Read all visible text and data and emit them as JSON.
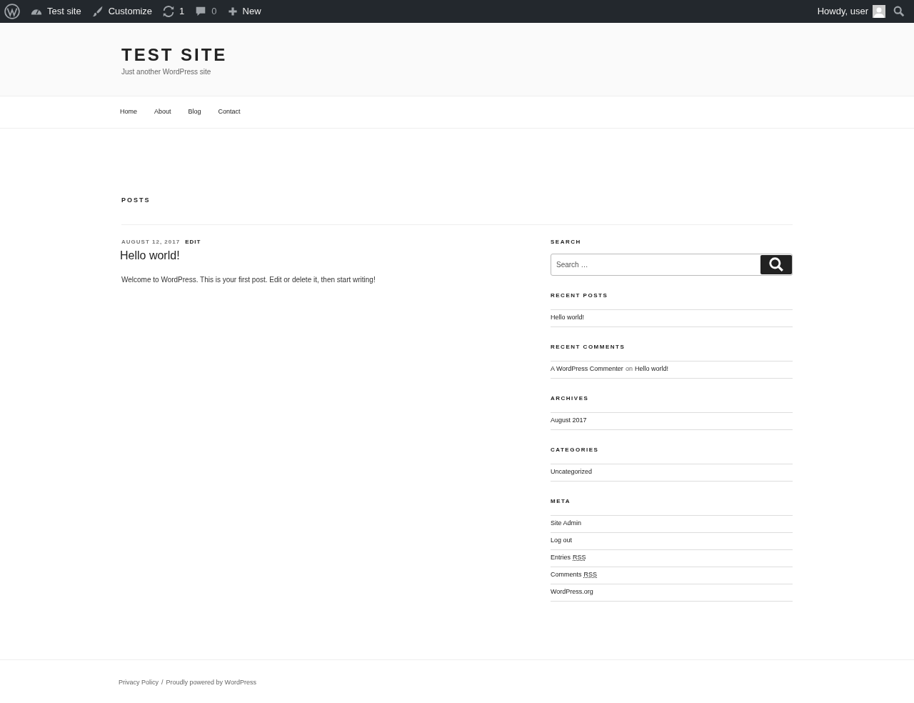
{
  "admin_bar": {
    "site": "Test site",
    "customize": "Customize",
    "updates": "1",
    "comments": "0",
    "new": "New",
    "greeting": "Howdy, user"
  },
  "site": {
    "title": "TEST SITE",
    "tagline": "Just another WordPress site"
  },
  "nav": [
    "Home",
    "About",
    "Blog",
    "Contact"
  ],
  "page_title": "POSTS",
  "post": {
    "date": "AUGUST 12, 2017",
    "edit": "EDIT",
    "title": "Hello world!",
    "excerpt": "Welcome to WordPress. This is your first post. Edit or delete it, then start writing!"
  },
  "sidebar": [
    {
      "kind": "search",
      "title": "SEARCH",
      "placeholder": "Search …"
    },
    {
      "kind": "list",
      "title": "RECENT POSTS",
      "items": [
        {
          "text": "Hello world!"
        }
      ]
    },
    {
      "kind": "comments",
      "title": "RECENT COMMENTS",
      "items": [
        {
          "author": "A WordPress Commenter",
          "joiner": "on",
          "post": "Hello world!"
        }
      ]
    },
    {
      "kind": "list",
      "title": "ARCHIVES",
      "items": [
        {
          "text": "August 2017"
        }
      ]
    },
    {
      "kind": "list",
      "title": "CATEGORIES",
      "items": [
        {
          "text": "Uncategorized"
        }
      ]
    },
    {
      "kind": "list",
      "title": "META",
      "items": [
        {
          "text": "Site Admin"
        },
        {
          "text": "Log out"
        },
        {
          "text": "Entries",
          "abbr": "RSS"
        },
        {
          "text": "Comments",
          "abbr": "RSS"
        },
        {
          "text": "WordPress.org"
        }
      ]
    }
  ],
  "footer": {
    "privacy": "Privacy Policy",
    "separator": "/",
    "powered": "Proudly powered by WordPress"
  }
}
